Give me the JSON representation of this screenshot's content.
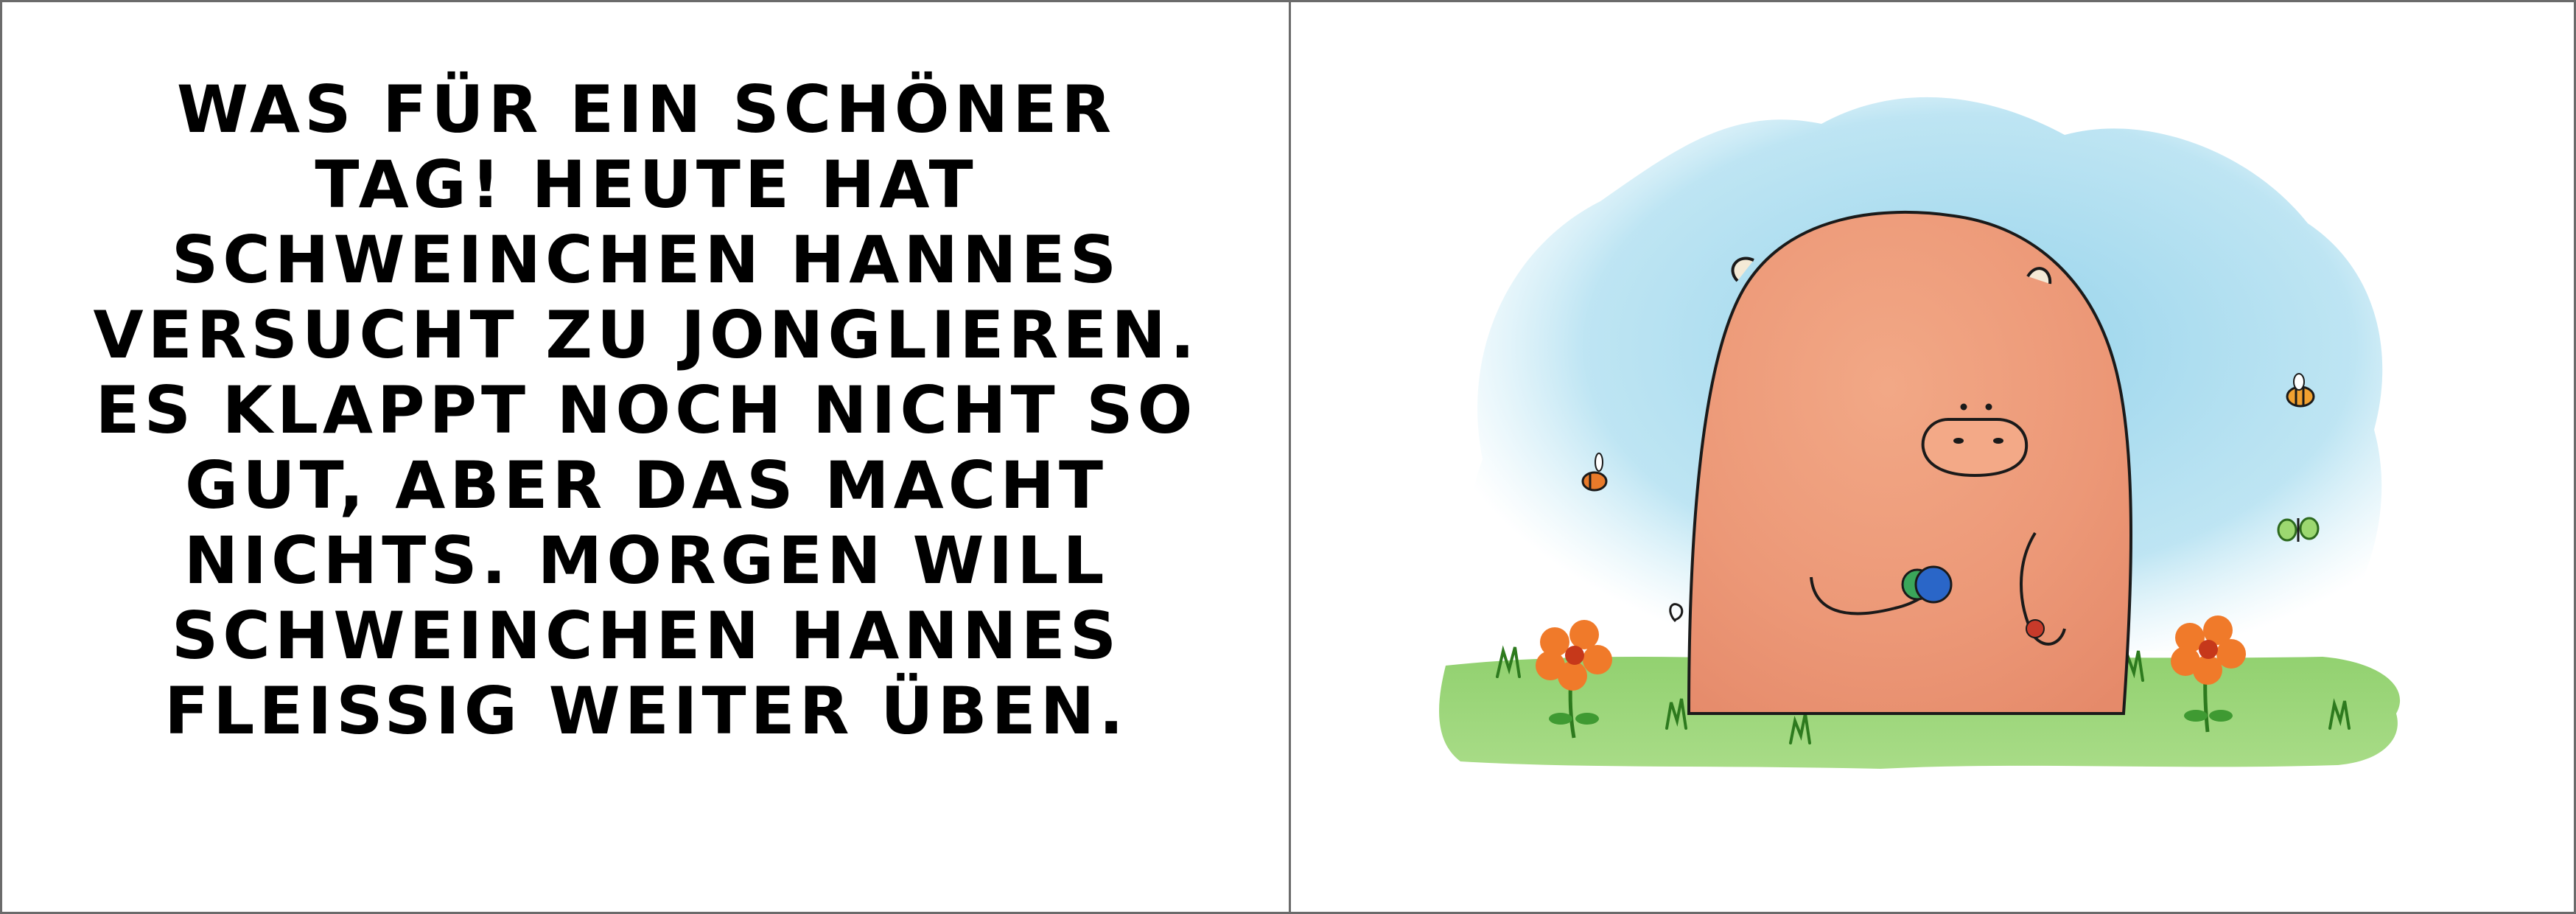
{
  "story": {
    "lines": [
      "WAS FÜR EIN SCHÖNER",
      "TAG! HEUTE HAT",
      "SCHWEINCHEN HANNES",
      "VERSUCHT ZU JONGLIEREN.",
      "ES KLAPPT NOCH NICHT SO",
      "GUT, ABER DAS MACHT",
      "NICHTS. MORGEN WILL",
      "SCHWEINCHEN HANNES",
      "FLEISSIG WEITER ÜBEN."
    ]
  },
  "illustration": {
    "colors": {
      "sky": "#a8d8ea",
      "grass": "#7cc65a",
      "pig": "#f0a27c",
      "flower": "#f07a2a",
      "ball_blue": "#2a66c8",
      "ball_red": "#c83a2a"
    }
  }
}
